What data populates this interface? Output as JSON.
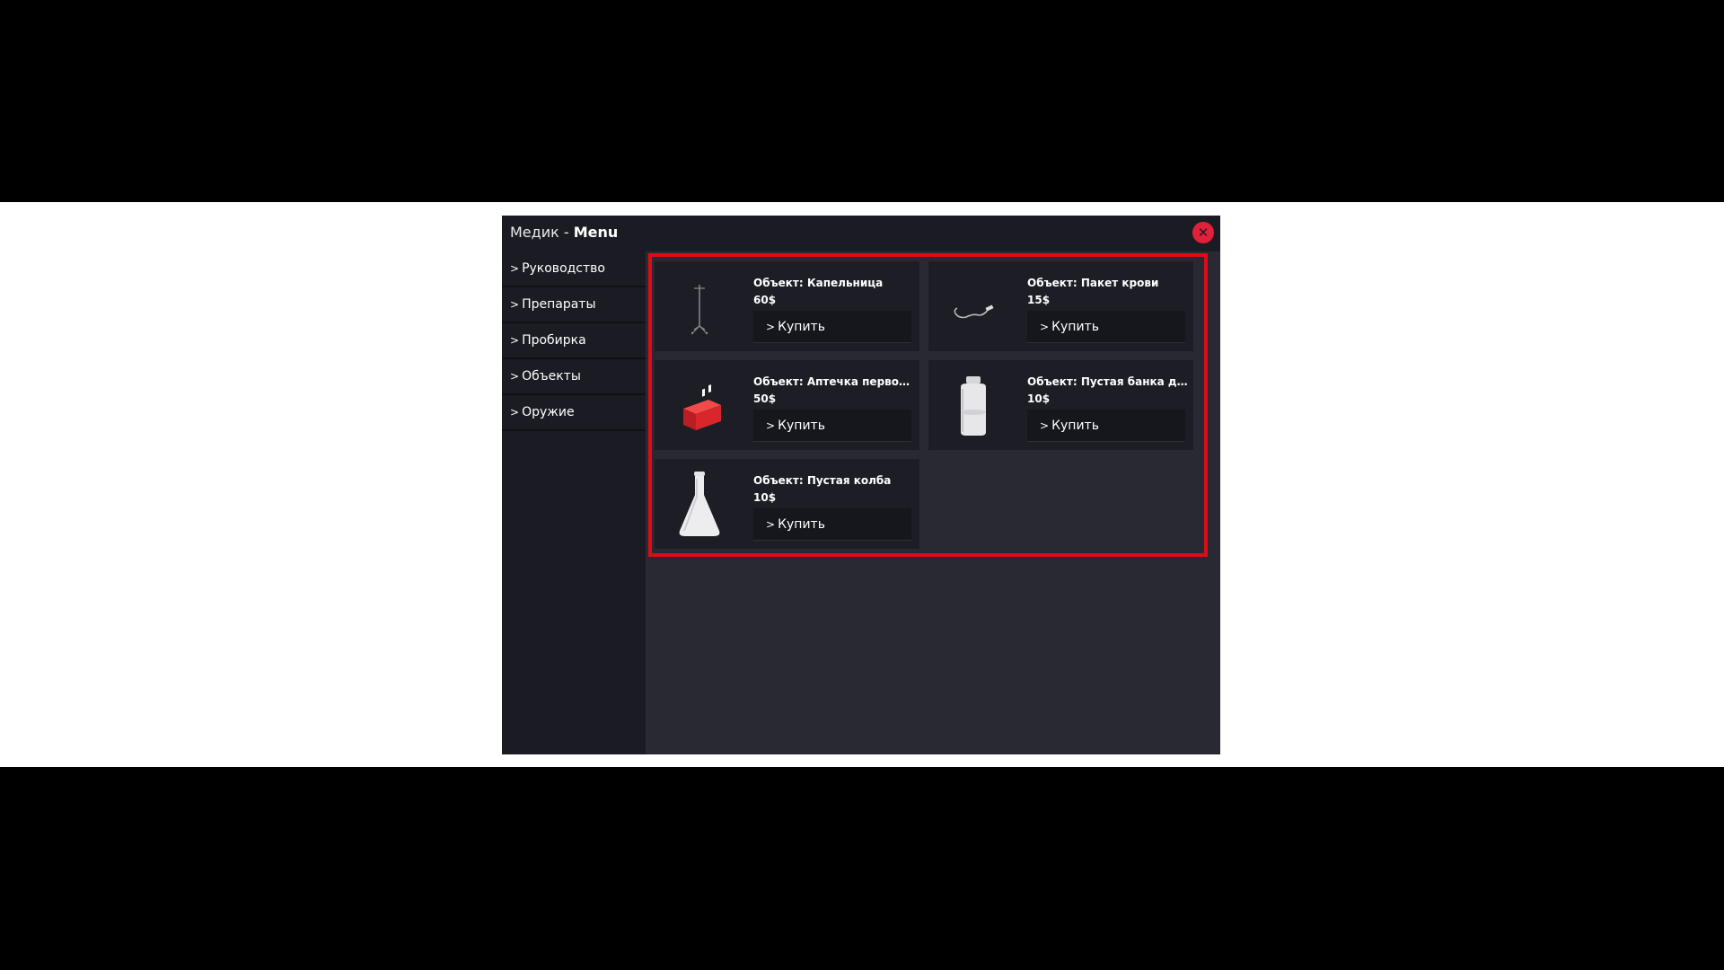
{
  "window": {
    "title_app": "Медик",
    "title_separator": "-",
    "title_menu": "Menu",
    "close_label": "✕"
  },
  "sidebar": {
    "chevron": ">",
    "items": [
      {
        "label": "Руководство"
      },
      {
        "label": "Препараты"
      },
      {
        "label": "Пробирка"
      },
      {
        "label": "Объекты"
      },
      {
        "label": "Оружие"
      }
    ]
  },
  "shop": {
    "buy_chevron": ">",
    "buy_label": "Купить",
    "items": [
      {
        "name": "Объект: Капельница",
        "price": "60$",
        "icon": "iv-drip-stand-icon"
      },
      {
        "name": "Объект: Пакет крови",
        "price": "15$",
        "icon": "blood-bag-icon"
      },
      {
        "name": "Объект: Аптечка первой ...",
        "price": "50$",
        "icon": "first-aid-kit-icon"
      },
      {
        "name": "Объект: Пустая банка для...",
        "price": "10$",
        "icon": "empty-jar-icon"
      },
      {
        "name": "Объект: Пустая колба",
        "price": "10$",
        "icon": "empty-flask-icon"
      }
    ]
  },
  "colors": {
    "accent_red": "#e00b14",
    "close_red": "#e2203a",
    "panel_dark": "#1b1c23",
    "content_bg": "#282932",
    "card_bg": "#1d1e25"
  }
}
